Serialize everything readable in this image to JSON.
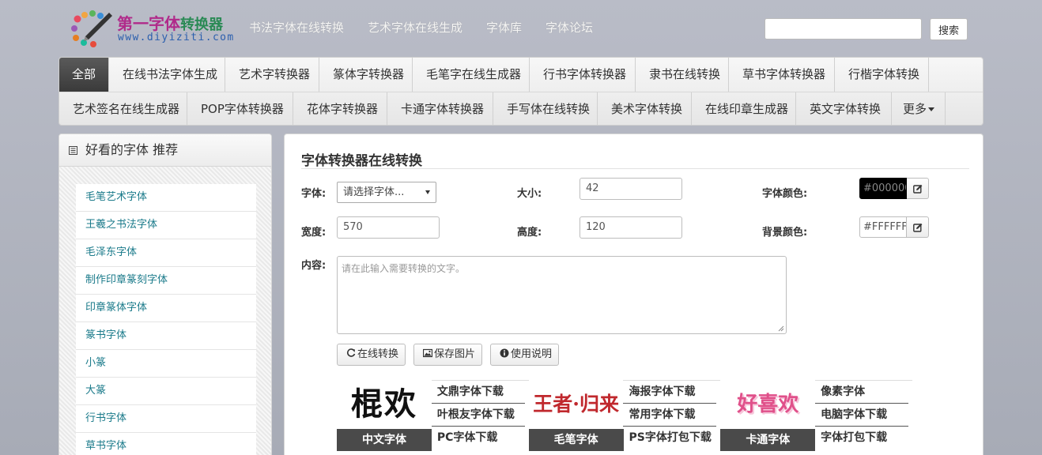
{
  "header": {
    "logo": {
      "title_main": "第一字体",
      "title_sub": "转换器",
      "url": "www.diyiziti.com"
    },
    "top_nav": [
      "书法字体在线转换",
      "艺术字体在线生成",
      "字体库",
      "字体论坛"
    ],
    "search": {
      "placeholder": "",
      "button_label": "搜索"
    }
  },
  "category_nav": {
    "row1": [
      "全部",
      "在线书法字体生成",
      "艺术字转换器",
      "篆体字转换器",
      "毛笔字在线生成器",
      "行书字体转换器",
      "隶书在线转换",
      "草书字体转换器",
      "行楷字体转换"
    ],
    "row2": [
      "艺术签名在线生成器",
      "POP字体转换器",
      "花体字转换器",
      "卡通字体转换器",
      "手写体在线转换",
      "美术字体转换",
      "在线印章生成器",
      "英文字体转换"
    ],
    "more_label": "更多",
    "active": "全部"
  },
  "sidebar": {
    "title": "好看的字体 推荐",
    "items": [
      "毛笔艺术字体",
      "王羲之书法字体",
      "毛泽东字体",
      "制作印章篆刻字体",
      "印章篆体字体",
      "篆书字体",
      "小篆",
      "大篆",
      "行书字体",
      "草书字体"
    ]
  },
  "converter": {
    "title": "字体转换器在线转换",
    "font_label": "字体:",
    "font_select": "请选择字体...",
    "size_label": "大小:",
    "size_value": "42",
    "font_color_label": "字体颜色:",
    "font_color_value": "#000000",
    "width_label": "宽度:",
    "width_value": "570",
    "height_label": "高度:",
    "height_value": "120",
    "bg_color_label": "背景颜色:",
    "bg_color_value": "#FFFFFF",
    "content_label": "内容:",
    "content_placeholder": "请在此输入需要转换的文字。",
    "buttons": {
      "convert": "在线转换",
      "save": "保存图片",
      "help": "使用说明"
    }
  },
  "ads": [
    {
      "caption": "中文字体",
      "art": "棍欢",
      "links": [
        "文鼎字体下载",
        "叶根友字体下载",
        "PC字体下载"
      ]
    },
    {
      "caption": "毛笔字体",
      "art": "王者·归来",
      "links": [
        "海报字体下载",
        "常用字体下载",
        "PS字体打包下载"
      ]
    },
    {
      "caption": "卡通字体",
      "art": "好喜欢",
      "links": [
        "像素字体",
        "电脑字体下载",
        "字体打包下载"
      ]
    }
  ],
  "colors": {
    "accent_link": "#1a7a8a",
    "logo_purple": "#b02a8a",
    "logo_green": "#2a8a55",
    "active_tab": "#4a4a4a",
    "art_red": "#c0282d",
    "art_pink": "#e0508a"
  }
}
